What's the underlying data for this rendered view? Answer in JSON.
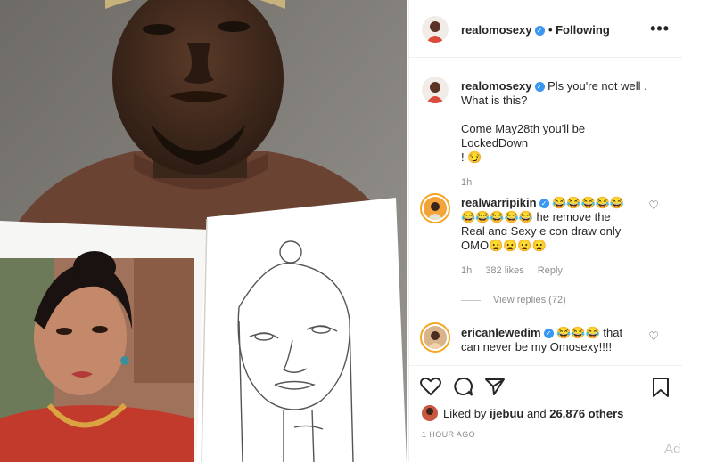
{
  "post": {
    "author": "realomosexy",
    "follow_status": "• Following",
    "more_label": "•••"
  },
  "comments": [
    {
      "username": "realomosexy",
      "verified": true,
      "line1": "Pls you're not well .",
      "line2": "What is this?",
      "line3": "Come May28th you'll be LockedDown",
      "line4": "! 😏",
      "time": "1h"
    },
    {
      "username": "realwarripikin",
      "verified": true,
      "line1": "😂😂😂😂😂",
      "line2": "😂😂😂😂😂 he remove the",
      "line3": "Real and Sexy e con draw only",
      "line4": "OMO😦😦😦😦",
      "time": "1h",
      "likes": "382 likes",
      "reply": "Reply",
      "view_replies": "View replies (72)"
    },
    {
      "username": "ericanlewedim",
      "verified": true,
      "line1": "😂😂😂 that",
      "line2": "can never be my Omosexy!!!!"
    }
  ],
  "actions": {
    "liked_by_prefix": "Liked by",
    "liked_by_user": "ijebuu",
    "liked_by_and": "and",
    "liked_by_count": "26,876 others",
    "timestamp": "1 HOUR AGO"
  },
  "watermark": "Ad"
}
